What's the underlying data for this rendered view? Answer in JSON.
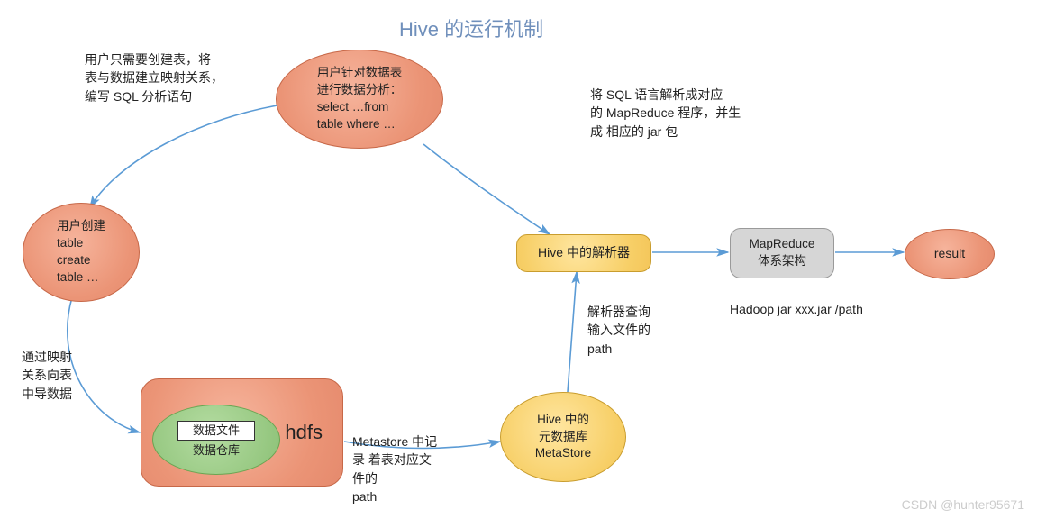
{
  "title": "Hive 的运行机制",
  "nodes": {
    "user_analysis": {
      "line1": "用户针对数据表",
      "line2": "进行数据分析：",
      "line3": "select …from",
      "line4": "table where …"
    },
    "user_create": {
      "line0": "用户创建",
      "line1": "table",
      "line2": "create",
      "line3": "table …"
    },
    "hdfs": {
      "label": "hdfs",
      "inner_ellipse": "数据仓库",
      "inner_box": "数据文件"
    },
    "metastore": {
      "line1": "Hive 中的",
      "line2": "元数据库",
      "line3": "MetaStore"
    },
    "parser": {
      "label": "Hive 中的解析器"
    },
    "mapreduce": {
      "line1": "MapReduce",
      "line2": "体系架构"
    },
    "result": {
      "label": "result"
    }
  },
  "labels": {
    "l1": "用户只需要创建表，将\n表与数据建立映射关系，\n编写 SQL 分析语句",
    "l2": "将  SQL  语言解析成对应\n的 MapReduce 程序，并生\n成 相应的 jar 包",
    "l3": "通过映射\n关系向表\n中导数据",
    "l4": "Metastore 中记\n录 着表对应文\n件的\npath",
    "l5": "解析器查询\n输入文件的\npath",
    "l6": "Hadoop jar xxx.jar /path"
  },
  "watermark": "CSDN @hunter95671"
}
